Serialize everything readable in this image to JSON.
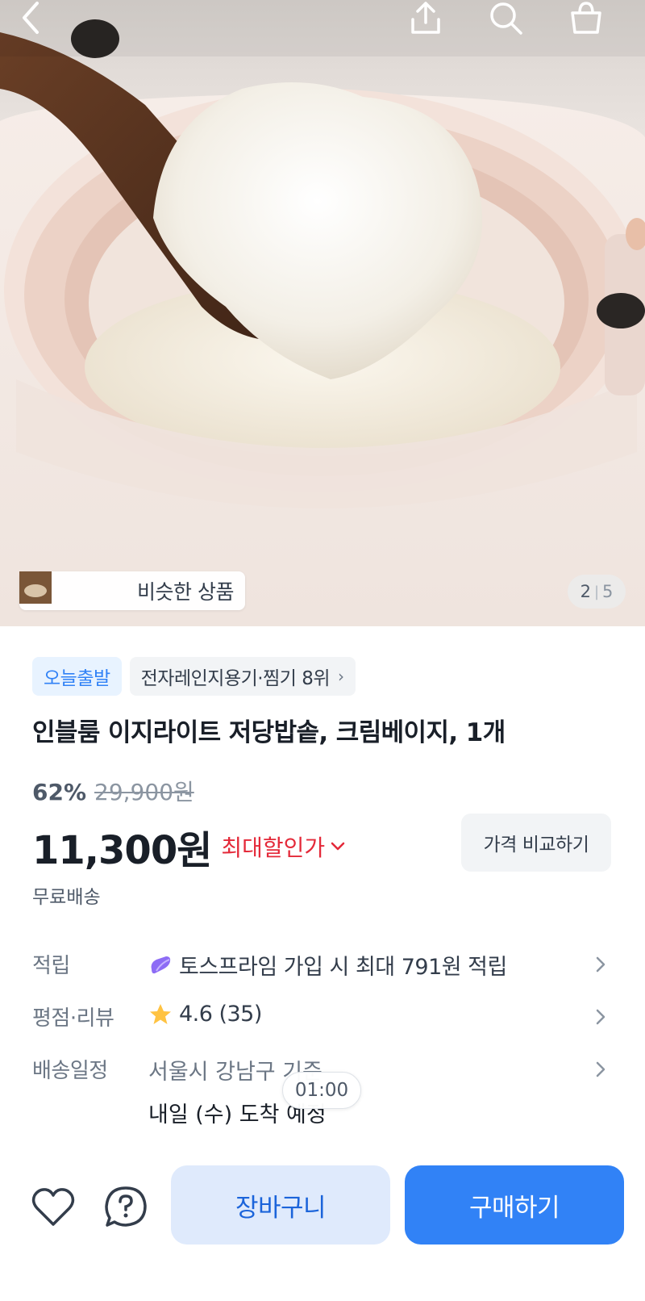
{
  "header": {
    "back_icon": "chevron-left-icon",
    "share_icon": "share-icon",
    "search_icon": "search-icon",
    "cart_icon": "shopping-bag-icon"
  },
  "gallery": {
    "similar_products_label": "비슷한 상품",
    "current_page": "2",
    "separator": "|",
    "total_pages": "5"
  },
  "product": {
    "badges": [
      "오늘출발",
      "전자레인지용기·찜기 8위"
    ],
    "title": "인블룸 이지라이트 저당밥솥, 크림베이지, 1개",
    "discount_rate": "62%",
    "original_price": "29,900원",
    "price": "11,300원",
    "max_discount_label": "최대할인가",
    "compare_button": "가격 비교하기",
    "shipping_fee": "무료배송"
  },
  "details": {
    "points": {
      "label": "적립",
      "value": "토스프라임 가입 시 최대 791원 적립"
    },
    "rating": {
      "label": "평점·리뷰",
      "score": "4.6",
      "count": "(35)"
    },
    "delivery": {
      "label": "배송일정",
      "location": "서울시 강남구 기준",
      "arrival": "내일 (수) 도착 예정"
    }
  },
  "video_timer": "01:00",
  "bottom_bar": {
    "wishlist_icon": "heart-icon",
    "inquiry_icon": "question-icon",
    "cart_button": "장바구니",
    "buy_button": "구매하기"
  },
  "colors": {
    "primary": "#3182f6",
    "primary_light": "#dfeafc",
    "discount_red": "#e42939",
    "text_main": "#191f28",
    "text_sub": "#6b7684"
  }
}
